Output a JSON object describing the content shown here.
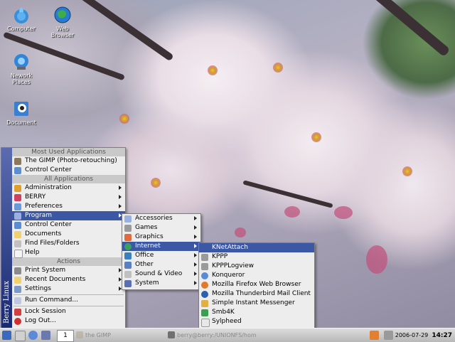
{
  "desktop_icons": [
    {
      "label": "Computer",
      "icon": "computer-icon"
    },
    {
      "label": "Web Browser",
      "icon": "globe-icon"
    },
    {
      "label": "Nework Places",
      "icon": "network-icon"
    },
    {
      "label": "Document",
      "icon": "document-icon"
    }
  ],
  "start_menu": {
    "side_label": "Berry Linux",
    "most_used_header": "Most Used Applications",
    "most_used": [
      "The GIMP (Photo-retouching)",
      "Control Center"
    ],
    "all_header": "All Applications",
    "all_apps": [
      "Administration",
      "BERRY",
      "Preferences",
      "Program",
      "Control Center",
      "Documents",
      "Find Files/Folders",
      "Help"
    ],
    "actions_header": "Actions",
    "actions": [
      "Print System",
      "Recent Documents",
      "Settings",
      "Run Command...",
      "Lock Session",
      "Log Out..."
    ]
  },
  "program_menu": [
    "Accessories",
    "Games",
    "Graphics",
    "Internet",
    "Office",
    "Other",
    "Sound & Video",
    "System"
  ],
  "internet_menu": [
    "KNetAttach",
    "KPPP",
    "KPPPLogview",
    "Konqueror",
    "Mozilla Firefox Web Browser",
    "Mozilla Thunderbird Mail Client",
    "Simple Instant Messenger",
    "Smb4K",
    "Sylpheed"
  ],
  "taskbar": {
    "pager_number": "1",
    "task1": "the GIMP",
    "task2": "berry@berry:/UNIONFS/hom",
    "date": "2006-07-29",
    "time": "14:27"
  },
  "colors": {
    "selection": "#3c57a3",
    "menu_bg": "#ededed",
    "menu_side": "#1a2a70"
  }
}
